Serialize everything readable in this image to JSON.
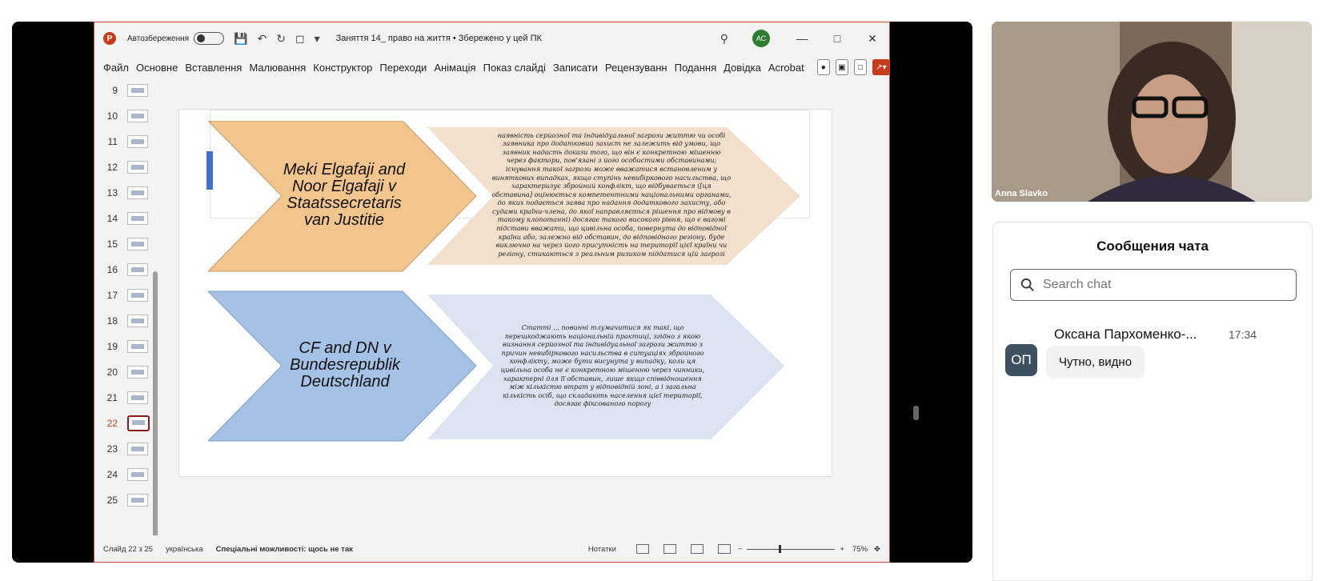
{
  "powerpoint": {
    "autosave_label": "Автозбереження",
    "doc_title": "Заняття 14_ право на життя • Збережено у цей ПК",
    "user_initials": "АС",
    "ribbon_tabs": [
      "Файл",
      "Основне",
      "Вставлення",
      "Малювання",
      "Конструктор",
      "Переходи",
      "Анімація",
      "Показ слайді",
      "Записати",
      "Рецензуванн",
      "Подання",
      "Довідка",
      "Acrobat"
    ],
    "thumbnails": [
      "9",
      "10",
      "11",
      "12",
      "13",
      "14",
      "15",
      "16",
      "17",
      "18",
      "19",
      "20",
      "21",
      "22",
      "23",
      "24",
      "25"
    ],
    "active_slide": "22",
    "status": {
      "slide_counter": "Слайд 22 з 25",
      "language": "українська",
      "accessibility": "Спеціальні можливості: щось не так",
      "notes": "Нотатки",
      "zoom": "75%"
    }
  },
  "slide": {
    "case1_title": "Meki Elgafaji and Noor Elgafaji v Staatssecretaris van Justitie",
    "case1_text": "наявність серйозної та індивідуальної загрози життю чи особі заявника про додатковий захист не залежить від умови, що заявник надасть докази того, що він є конкретною мішенню через фактори, пов'язані з його особистими обставинами; існування такої загрози може вважатися встановленим у виняткових випадках, якщо ступінь невибіркового насильства, що характеризує збройний конфлікт, що відбувається ([ця обставина] оцінюється компетентними національними органами, до яких подається заява про надання додаткового захисту, або судами країни-члена, до якої направляється рішення про відмову в такому клопотанні) досягає такого високого рівня, що є вагомі підстави вважати, що цивільна особа, повернута до відповідної країни або, залежно від обставин, до відповідного регіону, буде виключно на через його присутність на території цієї країни чи регіону, стикаються з реальним ризиком піддатися цій загрозі",
    "case2_title": "CF and DN v Bundesrepublik Deutschland",
    "case2_text": "Статті ... повинні тлумачитися як такі, що перешкоджають національній практиці, згідно з якою визнання серйозної та індивідуальної загрози життю з причин невибіркового насильства в ситуаціях збройного конфлікту, може бути висунута у випадку, коли ця цивільна особа не є конкретною мішенню через чинники, характерні для її обставин, лише якщо співвідношення між кількістю втрат у відповідній зоні, а і загальна кількість осіб, що складають населення цієї території, досягає фіксованого порогу"
  },
  "video": {
    "participant_name": "Anna Slavko"
  },
  "chat": {
    "title": "Сообщения чата",
    "search_placeholder": "Search chat",
    "messages": [
      {
        "initials": "ОП",
        "author": "Оксана Пархоменко-...",
        "time": "17:34",
        "text": "Чутно, видно"
      }
    ]
  },
  "colors": {
    "orange_chevron": "#f2c48e",
    "peach_chevron": "#f3e0cc",
    "blue_chevron": "#a5c2e6",
    "lightblue_chevron": "#dbe4f0",
    "ppt_accent": "#c43e1c"
  }
}
